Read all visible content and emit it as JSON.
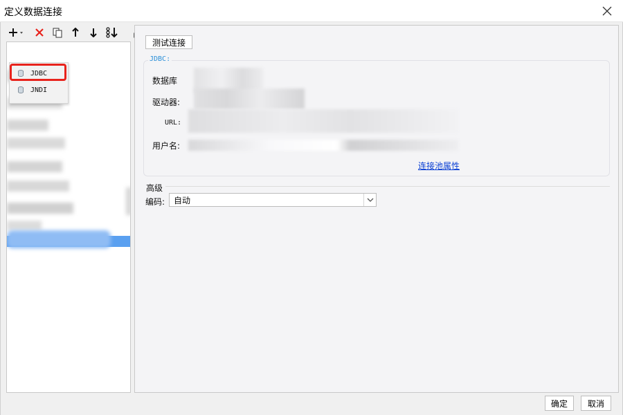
{
  "window": {
    "title": "定义数据连接"
  },
  "menu": {
    "items": [
      "JDBC",
      "JNDI"
    ]
  },
  "actions": {
    "test_connection": "测试连接"
  },
  "group": {
    "title": "JDBC:",
    "fields": {
      "database": "数据库",
      "driver": "驱动器:",
      "url": "URL:",
      "username": "用户名:"
    },
    "pool_link": "连接池属性"
  },
  "advanced": {
    "title": "高级",
    "encoding_label": "编码:",
    "encoding_value": "自动"
  },
  "footer": {
    "ok": "确定",
    "cancel": "取消"
  },
  "colors": {
    "accent": "#2a8fd8",
    "selection": "#5aa0f0",
    "highlight": "#e8231c",
    "delete": "#e8231c"
  }
}
